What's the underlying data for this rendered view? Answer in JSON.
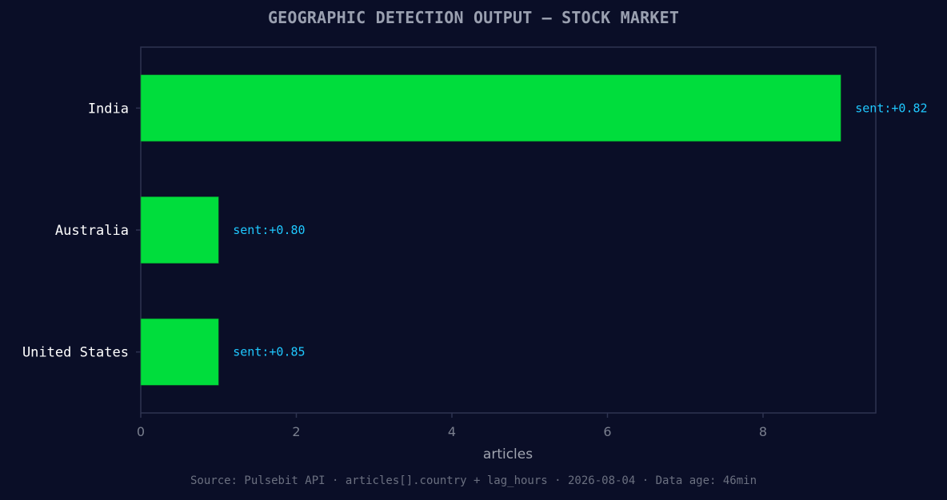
{
  "chart_data": {
    "type": "bar",
    "orientation": "horizontal",
    "title": "GEOGRAPHIC DETECTION OUTPUT — STOCK MARKET",
    "xlabel": "articles",
    "ylabel": "",
    "xlim": [
      0,
      9.45
    ],
    "xticks": [
      0,
      2,
      4,
      6,
      8
    ],
    "categories": [
      "India",
      "Australia",
      "United States"
    ],
    "values": [
      9,
      1,
      1
    ],
    "annotations": [
      "sent:+0.82",
      "sent:+0.80",
      "sent:+0.85"
    ],
    "grid": false,
    "legend": "none"
  },
  "footer": {
    "source": "Source: Pulsebit API · articles[].country + lag_hours · 2026-08-04 · Data age: 46min"
  },
  "colors": {
    "background": "#0a0e27",
    "bar": "#00dd3c",
    "annotation": "#1fc8ff",
    "axis": "#2e3350",
    "category_text": "#ffffff",
    "tick_text": "#7a7f8e",
    "axis_label": "#a0a4b0",
    "title": "#9aa0b0"
  }
}
